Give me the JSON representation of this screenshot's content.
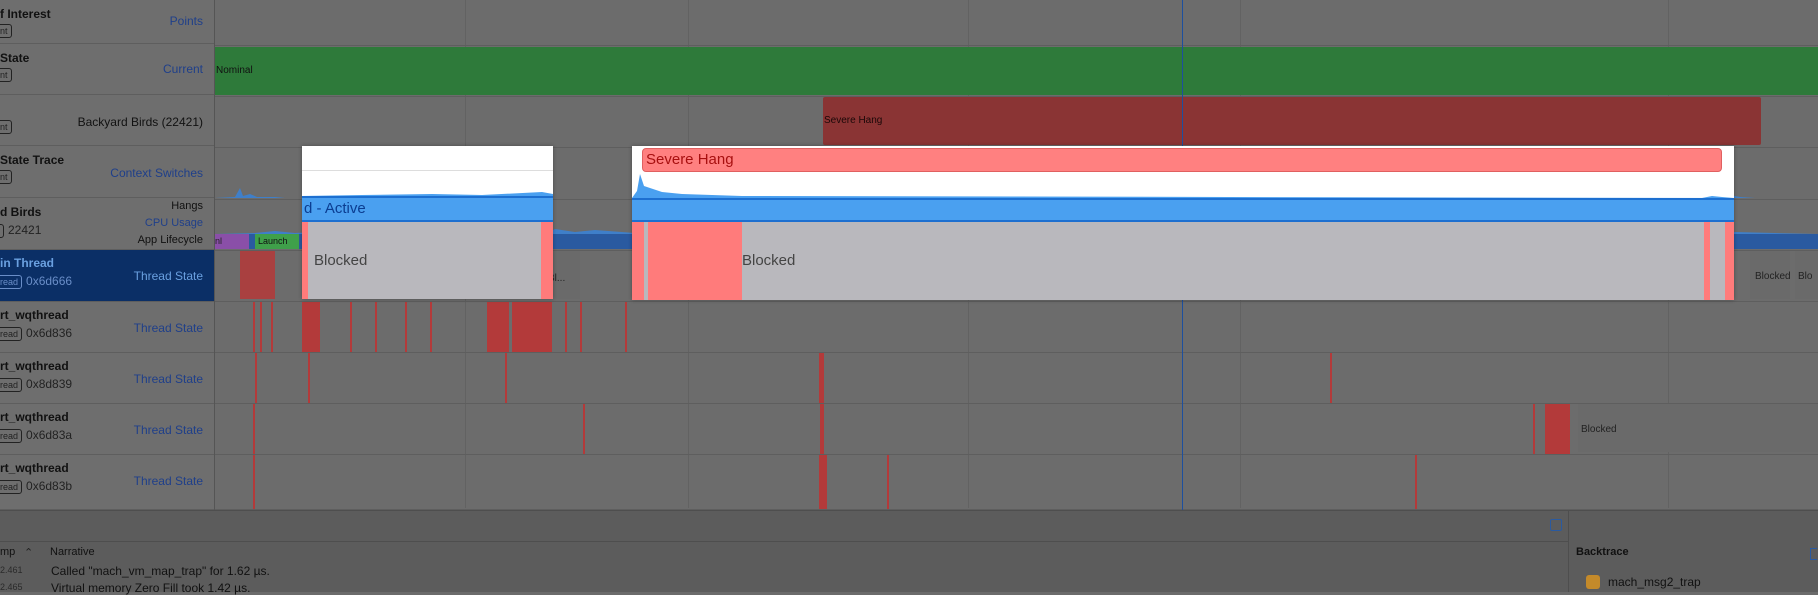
{
  "tracks": [
    {
      "title": "f Interest",
      "badge": "nt",
      "right": "Points"
    },
    {
      "title": " State",
      "badge": "nt",
      "right": "Current"
    },
    {
      "badge": "nt",
      "right": "Backyard Birds (22421)"
    },
    {
      "title": " State Trace",
      "badge": "nt",
      "right": "Context Switches"
    },
    {
      "title": "d Birds",
      "pid": "22421",
      "metrics": [
        "Hangs",
        "CPU Usage",
        "App Lifecycle"
      ]
    },
    {
      "title": "in Thread",
      "badge": "read",
      "sub": "0x6d666",
      "right": "Thread State"
    },
    {
      "title": "rt_wqthread",
      "badge": "read",
      "sub": "0x6d836",
      "right": "Thread State"
    },
    {
      "title": "rt_wqthread",
      "badge": "read",
      "sub": "0x8d839",
      "right": "Thread State"
    },
    {
      "title": "rt_wqthread",
      "badge": "read",
      "sub": "0x6d83a",
      "right": "Thread State"
    },
    {
      "title": "rt_wqthread",
      "badge": "read",
      "sub": "0x6d83b",
      "right": "Thread State"
    }
  ],
  "timeline": {
    "nominal_label": "Nominal",
    "severe_hang_label": "Severe Hang",
    "lifecycle_labels": [
      "nl",
      "Launch"
    ],
    "blocked_small": "Bl...",
    "blocked_right": [
      "Blocked",
      "Blo"
    ],
    "blocked_thread3": "Blocked"
  },
  "popup_left": {
    "active_label": "d - Active",
    "blocked_label": "Blocked"
  },
  "popup_right": {
    "hang_label": "Severe Hang",
    "blocked_label": "Blocked"
  },
  "bottom": {
    "columns": [
      "mp",
      "Narrative"
    ],
    "rows": [
      {
        "ts": "2.461",
        "text": "Called \"mach_vm_map_trap\" for 1.62 µs."
      },
      {
        "ts": "2.465",
        "text": "Virtual memory Zero Fill took 1.42 µs."
      }
    ],
    "backtrace_title": "Backtrace",
    "backtrace_frames": [
      "mach_msg2_trap"
    ]
  },
  "colors": {
    "accent": "#4aa0f0",
    "hang": "#ff8080",
    "nominal": "#2e7a3a",
    "selected": "#0b2f66"
  }
}
